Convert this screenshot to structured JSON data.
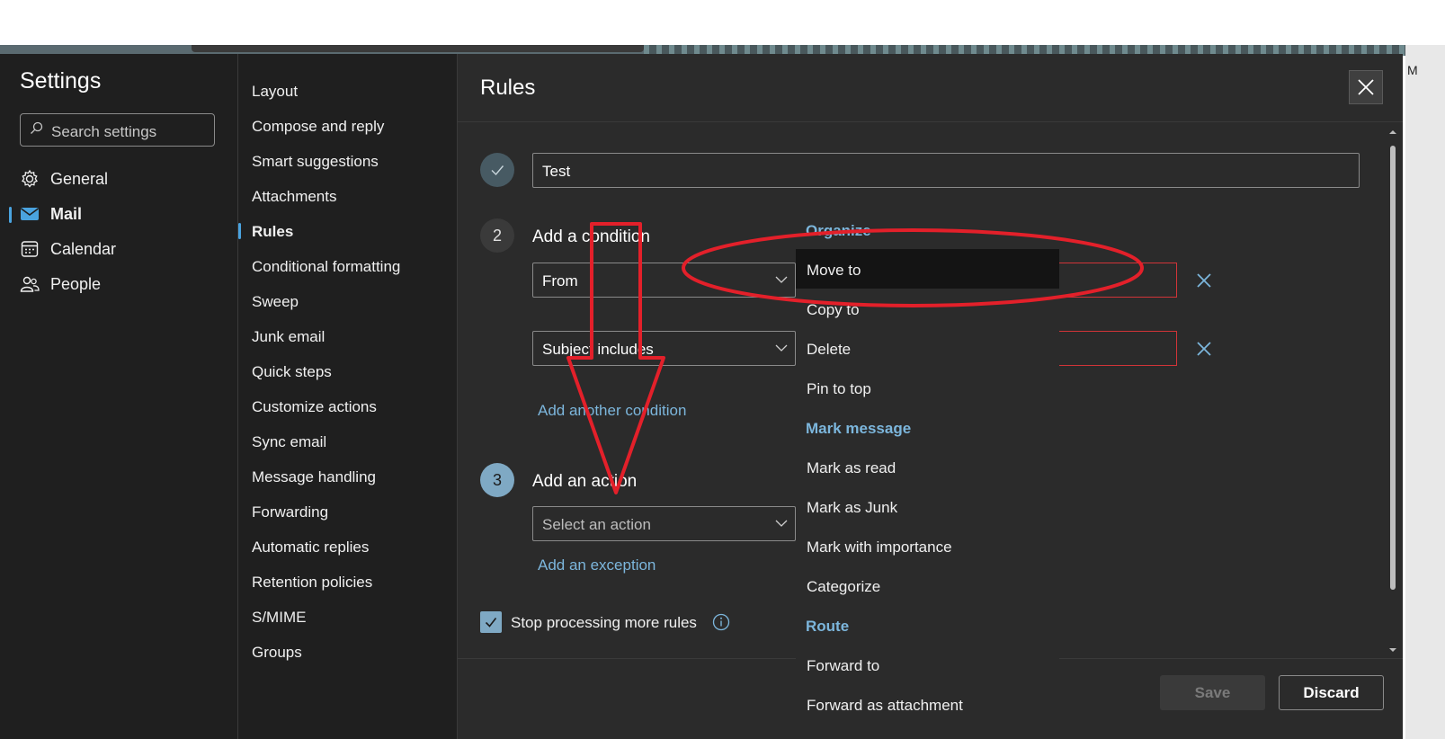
{
  "settings": {
    "title": "Settings",
    "search_placeholder": "Search settings",
    "categories": [
      {
        "label": "General",
        "icon": "gear-icon"
      },
      {
        "label": "Mail",
        "icon": "mail-icon",
        "selected": true
      },
      {
        "label": "Calendar",
        "icon": "calendar-icon"
      },
      {
        "label": "People",
        "icon": "people-icon"
      }
    ]
  },
  "mail_nav": {
    "items": [
      "Layout",
      "Compose and reply",
      "Smart suggestions",
      "Attachments",
      "Rules",
      "Conditional formatting",
      "Sweep",
      "Junk email",
      "Quick steps",
      "Customize actions",
      "Sync email",
      "Message handling",
      "Forwarding",
      "Automatic replies",
      "Retention policies",
      "S/MIME",
      "Groups"
    ],
    "selected": "Rules"
  },
  "rules": {
    "title": "Rules",
    "rule_name": "Test",
    "step2": "2",
    "step3": "3",
    "condition_heading": "Add a condition",
    "conditions": [
      "From",
      "Subject includes"
    ],
    "add_condition": "Add another condition",
    "action_heading": "Add an action",
    "action_placeholder": "Select an action",
    "add_exception": "Add an exception",
    "stop_processing": "Stop processing more rules",
    "stop_processing_checked": true,
    "save": "Save",
    "discard": "Discard"
  },
  "action_menu": {
    "organize_header": "Organize",
    "organize_items": [
      "Move to",
      "Copy to",
      "Delete",
      "Pin to top"
    ],
    "mark_header": "Mark message",
    "mark_items": [
      "Mark as read",
      "Mark as Junk",
      "Mark with importance",
      "Categorize"
    ],
    "route_header": "Route",
    "route_items": [
      "Forward to",
      "Forward as attachment"
    ],
    "highlighted": "Move to"
  },
  "colors": {
    "accent": "#4aa3df",
    "link": "#7cb6dc",
    "annotation": "#e3202a",
    "error_border": "#d13438"
  },
  "edge_text": "M"
}
